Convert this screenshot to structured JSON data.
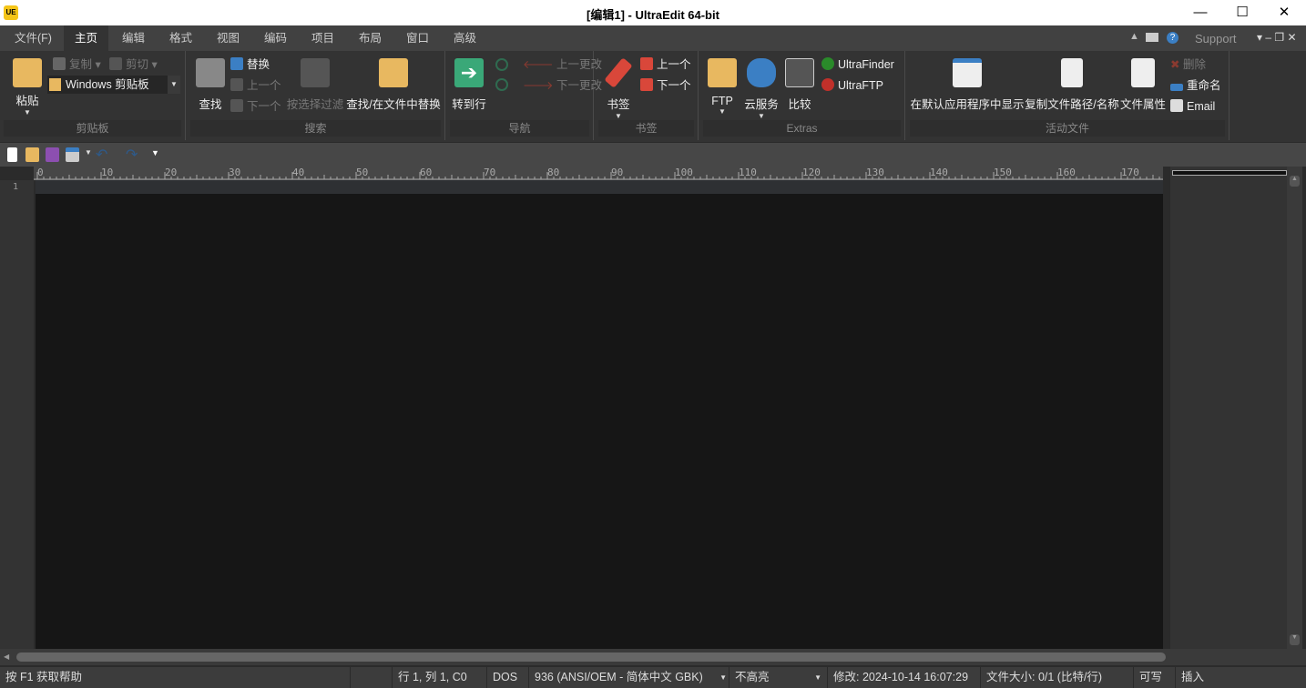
{
  "window": {
    "title": "[编辑1] - UltraEdit 64-bit",
    "logo": "UE",
    "minimize": "—",
    "maximize": "☐",
    "close": "✕"
  },
  "tabs": [
    "文件(F)",
    "主页",
    "编辑",
    "格式",
    "视图",
    "编码",
    "项目",
    "布局",
    "窗口",
    "高级"
  ],
  "active_tab": "主页",
  "ribbon_right": {
    "support": "Support"
  },
  "groups": {
    "clipboard": {
      "label": "剪贴板",
      "paste": "粘贴",
      "copy": "复制",
      "cut": "剪切",
      "clipboard_select": "Windows 剪贴板"
    },
    "search": {
      "label": "搜索",
      "find": "查找",
      "replace": "替换",
      "prev": "上一个",
      "next": "下一个",
      "filter": "按选择过滤",
      "find_in_files": "查找/在文件中替换"
    },
    "navigation": {
      "label": "导航",
      "goto": "转到行",
      "prev_change": "上一更改",
      "next_change": "下一更改"
    },
    "bookmarks": {
      "label": "书签",
      "bookmark": "书签",
      "prev": "上一个",
      "next": "下一个"
    },
    "extras": {
      "label": "Extras",
      "ftp": "FTP",
      "cloud": "云服务",
      "compare": "比较",
      "ultrafinder": "UltraFinder",
      "ultraftp": "UltraFTP"
    },
    "active_file": {
      "label": "活动文件",
      "show_default": "在默认应用程序中显示",
      "copy_path": "复制文件路径/名称",
      "properties": "文件属性",
      "delete": "删除",
      "rename": "重命名",
      "email": "Email"
    }
  },
  "ruler": {
    "labels": [
      0,
      10,
      20,
      30,
      40,
      50,
      60,
      70,
      80,
      90,
      100,
      110,
      120,
      130,
      140,
      150,
      160,
      170
    ]
  },
  "editor": {
    "line_numbers": [
      "1"
    ],
    "content": ""
  },
  "status": {
    "help": "按 F1 获取帮助",
    "position": "行 1, 列 1, C0",
    "line_ending": "DOS",
    "encoding": "936  (ANSI/OEM - 简体中文 GBK)",
    "highlight": "不高亮",
    "modified": "修改:   2024-10-14 16:07:29",
    "filesize": "文件大小:   0/1   (比特/行)",
    "writable": "可写",
    "insert": "插入"
  },
  "colors": {
    "accent_green": "#3aa878",
    "bookmark_red": "#d9473a",
    "folder": "#e8b860",
    "save_purple": "#8c4fb0",
    "cloud_blue": "#3b7fc4"
  }
}
